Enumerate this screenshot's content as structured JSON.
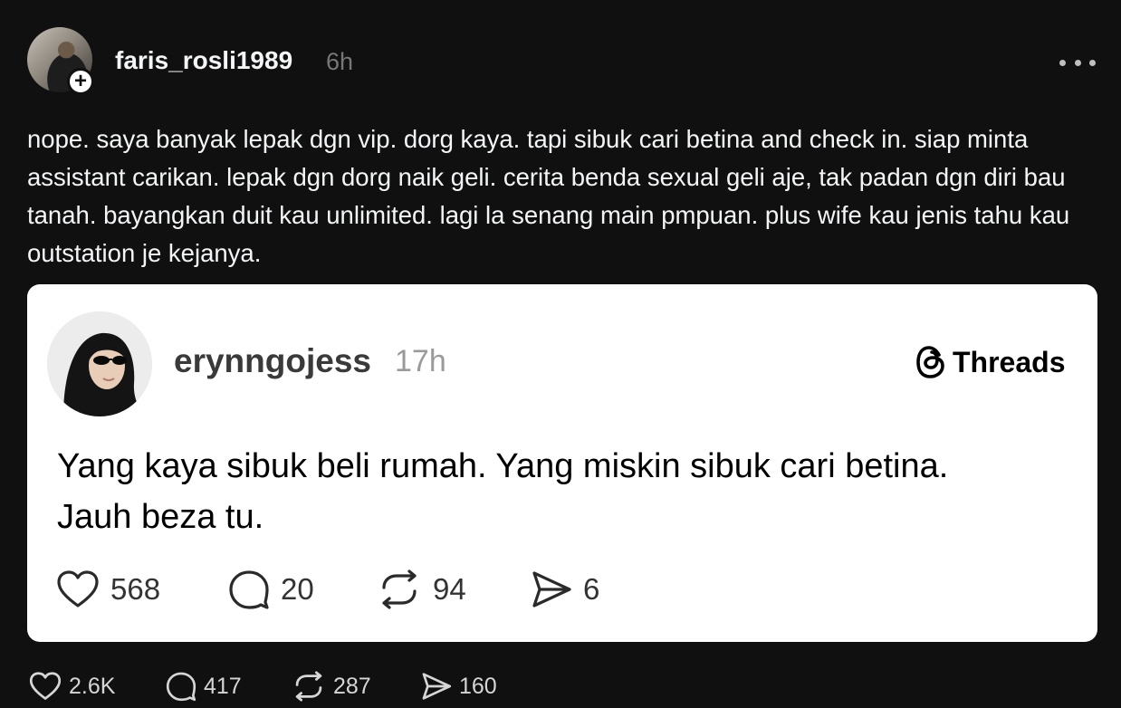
{
  "post": {
    "username": "faris_rosli1989",
    "time": "6h",
    "follow_glyph": "+",
    "text": "nope. saya banyak lepak dgn vip. dorg kaya. tapi sibuk cari betina and check in. siap minta assistant carikan. lepak dgn dorg naik geli. cerita benda sexual geli aje, tak padan dgn diri bau tanah. bayangkan duit kau unlimited. lagi la senang main pmpuan. plus wife kau jenis tahu kau outstation je kejanya.",
    "stats": {
      "likes": "2.6K",
      "replies": "417",
      "reposts": "287",
      "shares": "160"
    }
  },
  "quote": {
    "username": "erynngojess",
    "time": "17h",
    "brand": "Threads",
    "text_line1": "Yang kaya sibuk beli rumah. Yang miskin sibuk cari betina.",
    "text_line2": "Jauh beza tu.",
    "stats": {
      "likes": "568",
      "replies": "20",
      "reposts": "94",
      "shares": "6"
    }
  },
  "icons": {
    "like": "heart-icon",
    "reply": "comment-icon",
    "repost": "repost-icon",
    "share": "send-icon",
    "more": "more-dots-icon",
    "brand": "threads-logo-icon"
  },
  "colors": {
    "background": "#101010",
    "text_primary": "#f3f5f7",
    "text_muted": "#777777",
    "card": "#ffffff"
  }
}
